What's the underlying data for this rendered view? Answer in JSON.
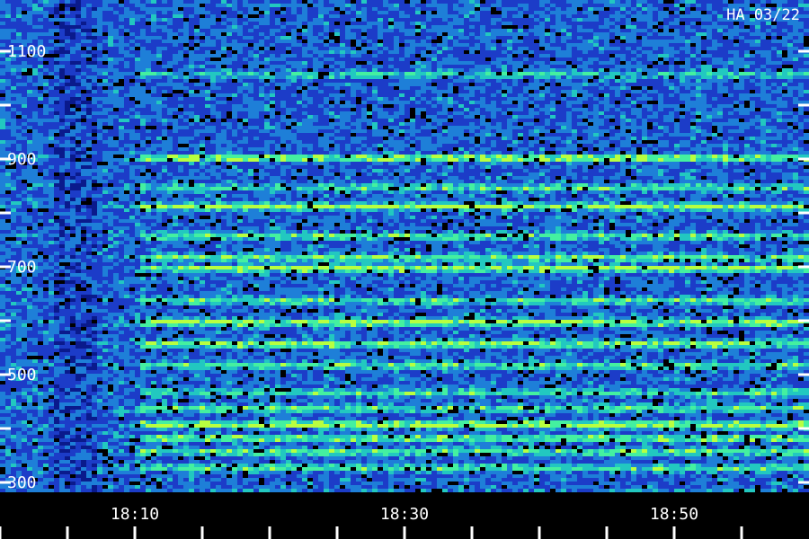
{
  "chart_data": {
    "type": "heatmap",
    "title": "",
    "xlabel": "",
    "ylabel": "",
    "stamp": "HA 03/22",
    "x_tick_labels": [
      "18:10",
      "18:30",
      "18:50"
    ],
    "x_range_minutes": [
      0,
      59
    ],
    "x_labeled_minutes": [
      10,
      30,
      50
    ],
    "x_minor_step_minutes": 5,
    "y_ticks": [
      300,
      500,
      700,
      900,
      1100
    ],
    "y_tick_labels": [
      "300",
      "500",
      "700",
      "900",
      "1100"
    ],
    "y_minor_step": 100,
    "ylim": [
      300,
      1100
    ],
    "colormap": [
      "#000000",
      "#0a1a8c",
      "#1c3cc8",
      "#1e7fd8",
      "#22c8c0",
      "#44f0a0",
      "#b8ff40"
    ],
    "horizontal_bands": [
      {
        "freq": 280,
        "intensity": 0.8
      },
      {
        "freq": 330,
        "intensity": 0.55
      },
      {
        "freq": 360,
        "intensity": 0.6
      },
      {
        "freq": 385,
        "intensity": 0.7
      },
      {
        "freq": 410,
        "intensity": 0.9
      },
      {
        "freq": 440,
        "intensity": 0.55
      },
      {
        "freq": 470,
        "intensity": 0.5
      },
      {
        "freq": 520,
        "intensity": 0.55
      },
      {
        "freq": 560,
        "intensity": 0.75
      },
      {
        "freq": 600,
        "intensity": 0.8
      },
      {
        "freq": 640,
        "intensity": 0.55
      },
      {
        "freq": 700,
        "intensity": 0.85
      },
      {
        "freq": 720,
        "intensity": 0.65
      },
      {
        "freq": 760,
        "intensity": 0.55
      },
      {
        "freq": 815,
        "intensity": 0.75
      },
      {
        "freq": 850,
        "intensity": 0.55
      },
      {
        "freq": 905,
        "intensity": 0.8
      },
      {
        "freq": 1060,
        "intensity": 0.4
      }
    ],
    "interference_burst_minutes": [
      4,
      7
    ]
  }
}
